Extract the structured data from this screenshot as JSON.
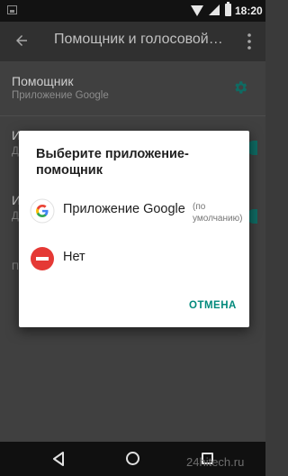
{
  "status_bar": {
    "time": "18:20"
  },
  "toolbar": {
    "title": "Помощник и голосовой…"
  },
  "settings": {
    "assistant": {
      "title": "Помощник",
      "subtitle": "Приложение Google"
    },
    "row2_initial": "И",
    "row2_sub_initial": "Д",
    "row3_initial": "И",
    "row3_sub_initial": "Д",
    "row4_initial": "П"
  },
  "dialog": {
    "title": "Выберите приложение-помощник",
    "options": [
      {
        "label": "Приложение Google",
        "note": "(по умолчанию)",
        "icon": "google-g-icon"
      },
      {
        "label": "Нет",
        "icon": "none-minus-icon"
      }
    ],
    "cancel_label": "ОТМЕНА"
  },
  "watermark": "24hitech.ru",
  "colors": {
    "accent": "#00897b",
    "toggle_on": "#009688",
    "none_red": "#e53935"
  }
}
